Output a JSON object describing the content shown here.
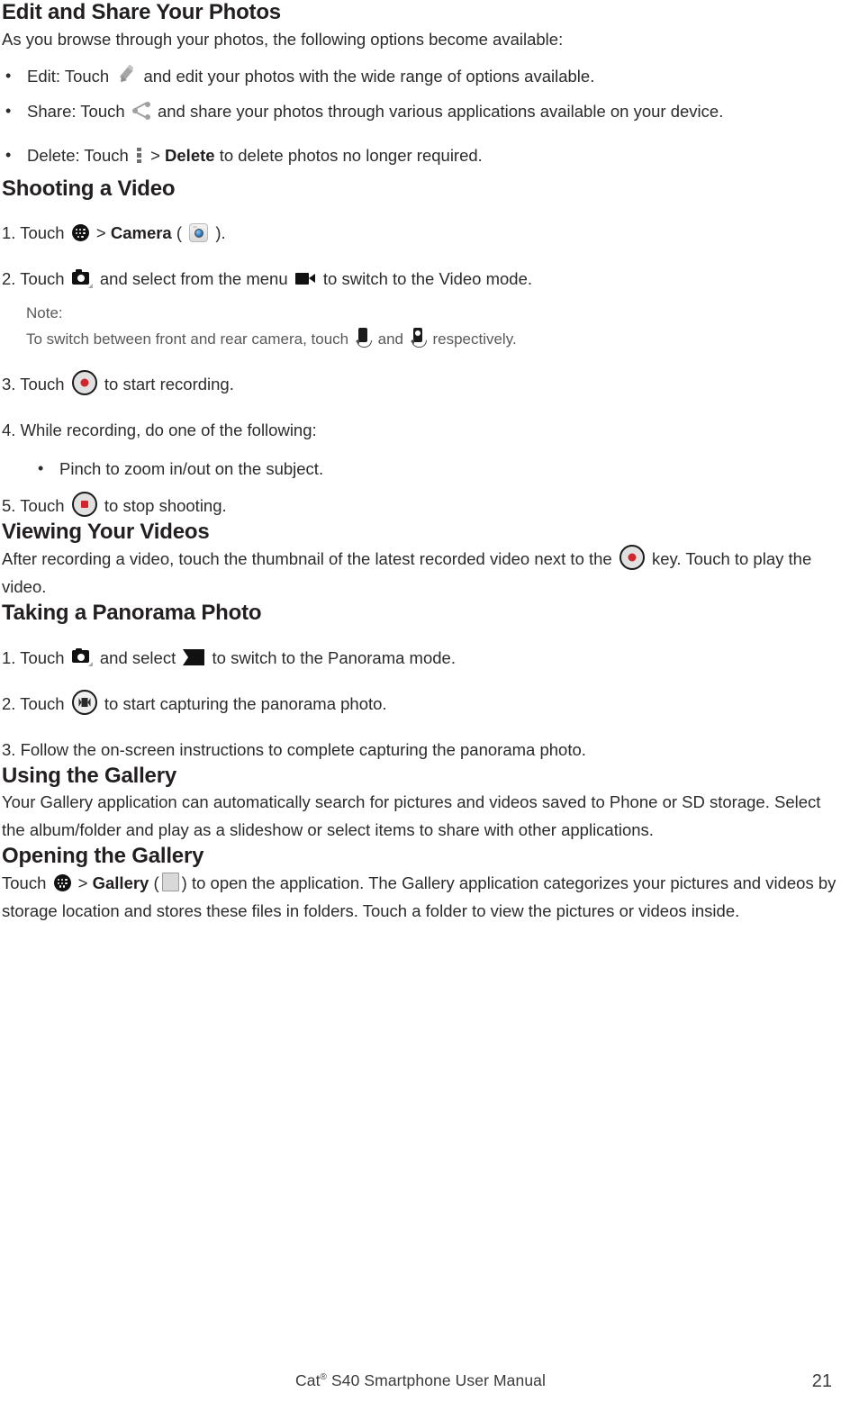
{
  "document": {
    "footer_text_prefix": "Cat",
    "footer_registered_mark": "®",
    "footer_text_suffix": " S40 Smartphone User Manual",
    "page_number": "21"
  },
  "sections": {
    "edit_share": {
      "heading": "Edit and Share Your Photos",
      "intro": "As you browse through your photos, the following options become available:",
      "bullets": {
        "edit_prefix": "Edit: Touch",
        "edit_suffix": "and edit your photos with the wide range of options available.",
        "share_prefix": "Share: Touch",
        "share_suffix": "and share your photos through various applications available on your device.",
        "delete_prefix": "Delete: Touch",
        "delete_separator": ">",
        "delete_bold": "Delete",
        "delete_suffix": "to delete photos no longer required."
      }
    },
    "shooting_video": {
      "heading": "Shooting a Video",
      "step1_prefix": "1. Touch",
      "step1_separator": ">",
      "step1_bold": "Camera",
      "step1_open_paren": "(",
      "step1_close_paren": ").",
      "step2_prefix": "2. Touch",
      "step2_mid": "and select from the menu",
      "step2_suffix": "to switch to the Video mode.",
      "note_label": "Note:",
      "note_prefix": "To switch between front and rear camera, touch",
      "note_mid": "and",
      "note_suffix": "respectively.",
      "step3_prefix": "3. Touch",
      "step3_suffix": "to start recording.",
      "step4": "4. While recording, do one of the following:",
      "step4_bullet": "Pinch to zoom in/out on the subject.",
      "step5_prefix": "5. Touch",
      "step5_suffix": "to stop shooting."
    },
    "viewing_videos": {
      "heading": "Viewing Your Videos",
      "body_prefix": "After recording a video, touch the thumbnail of the latest recorded video next to the",
      "body_suffix": "key. Touch to play the video."
    },
    "panorama": {
      "heading": "Taking a Panorama Photo",
      "step1_prefix": "1. Touch",
      "step1_mid": "and select",
      "step1_suffix": "to switch to the Panorama mode.",
      "step2_prefix": "2. Touch",
      "step2_suffix": "to start capturing the panorama photo.",
      "step3": "3. Follow the on-screen instructions to complete capturing the panorama photo."
    },
    "using_gallery": {
      "heading": "Using the Gallery",
      "body": "Your Gallery application can automatically search for pictures and videos saved to Phone or SD storage. Select the album/folder and play as a slideshow or select items to share with other applications."
    },
    "opening_gallery": {
      "heading": "Opening the Gallery",
      "body_prefix": "Touch",
      "body_separator": ">",
      "body_bold": "Gallery",
      "body_open_paren": "(",
      "body_suffix": ") to open the application. The Gallery application categorizes your pictures and videos by storage location and stores these files in folders. Touch a folder to view the pictures or videos inside."
    }
  },
  "icons": {
    "apps": "apps-grid-icon",
    "camera_app": "camera-app-icon",
    "camera_mode": "camera-mode-icon",
    "video_mode": "video-mode-icon",
    "pencil": "pencil-edit-icon",
    "share": "share-icon",
    "overflow": "overflow-menu-icon",
    "record": "record-button-icon",
    "stop": "stop-button-icon",
    "panorama": "panorama-mode-icon",
    "panorama_capture": "panorama-capture-button-icon",
    "front_camera": "front-camera-switch-icon",
    "rear_camera": "rear-camera-switch-icon",
    "gallery_app": "gallery-app-icon"
  },
  "colors": {
    "text": "#2b2b2b",
    "heading": "#231f20",
    "note": "#58595b",
    "record_red": "#d0262c",
    "icon_gray": "#a0a0a0"
  }
}
